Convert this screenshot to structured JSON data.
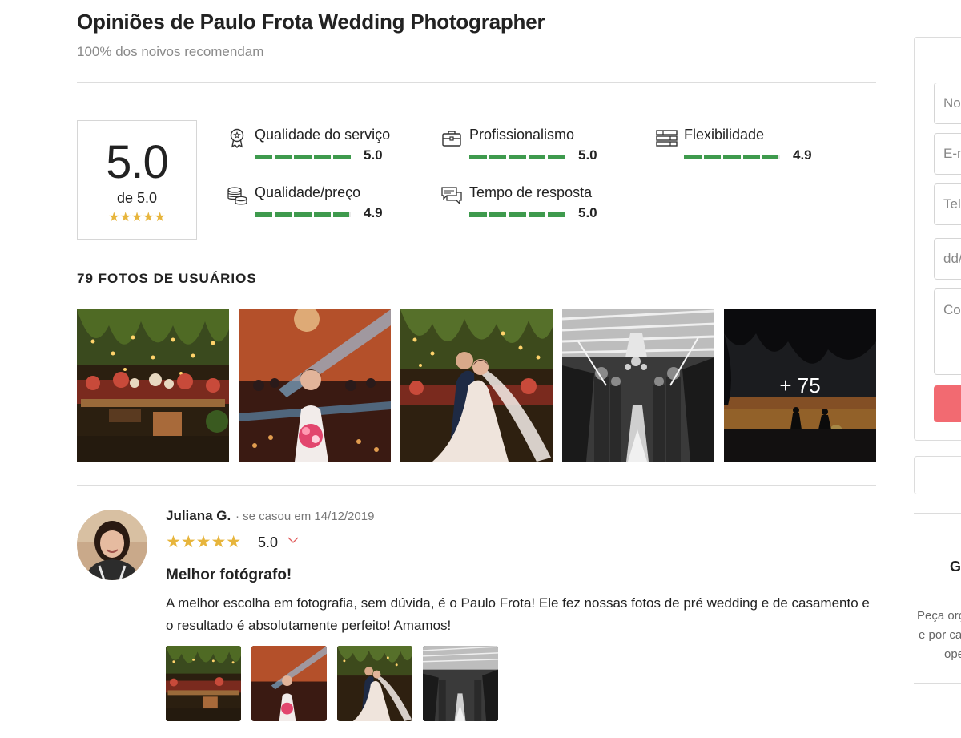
{
  "header": {
    "title": "Opiniões de Paulo Frota Wedding Photographer",
    "subtitle": "100% dos noivos recomendam"
  },
  "summary": {
    "score": "5.0",
    "out_of": "de 5.0",
    "stars": "★★★★★",
    "star_color": "#e7b53c"
  },
  "metrics": [
    {
      "label": "Qualidade do serviço",
      "value": "5.0",
      "fraction": 1.0,
      "icon": "award-ribbon-icon"
    },
    {
      "label": "Profissionalismo",
      "value": "5.0",
      "fraction": 1.0,
      "icon": "briefcase-icon"
    },
    {
      "label": "Flexibilidade",
      "value": "4.9",
      "fraction": 0.98,
      "icon": "layers-icon"
    },
    {
      "label": "Qualidade/preço",
      "value": "4.9",
      "fraction": 0.98,
      "icon": "coins-icon"
    },
    {
      "label": "Tempo de resposta",
      "value": "5.0",
      "fraction": 1.0,
      "icon": "chat-bubbles-icon"
    }
  ],
  "bar_color": "#3e9a4d",
  "photos": {
    "heading": "79 FOTOS DE USUÁRIOS",
    "more_label": "+ 75"
  },
  "review": {
    "author": "Juliana G.",
    "date": "· se casou em 14/12/2019",
    "stars": "★★★★★",
    "rating": "5.0",
    "title": "Melhor fotógrafo!",
    "text": "A melhor escolha em fotografia, sem dúvida, é o Paulo Frota! Ele fez nossas fotos de pré wedding e de casamento e o resultado é absolutamente perfeito! Amamos!"
  },
  "sidebar": {
    "name_placeholder": "No",
    "email_placeholder": "E-m",
    "phone_placeholder": "Tel",
    "date_placeholder": "dd/",
    "comment_placeholder": "Co",
    "heading_fragment": "G",
    "text_line_1": "Peça orç",
    "text_line_2": "e por ca",
    "text_line_3": "ope",
    "button_color": "#f26a71"
  }
}
